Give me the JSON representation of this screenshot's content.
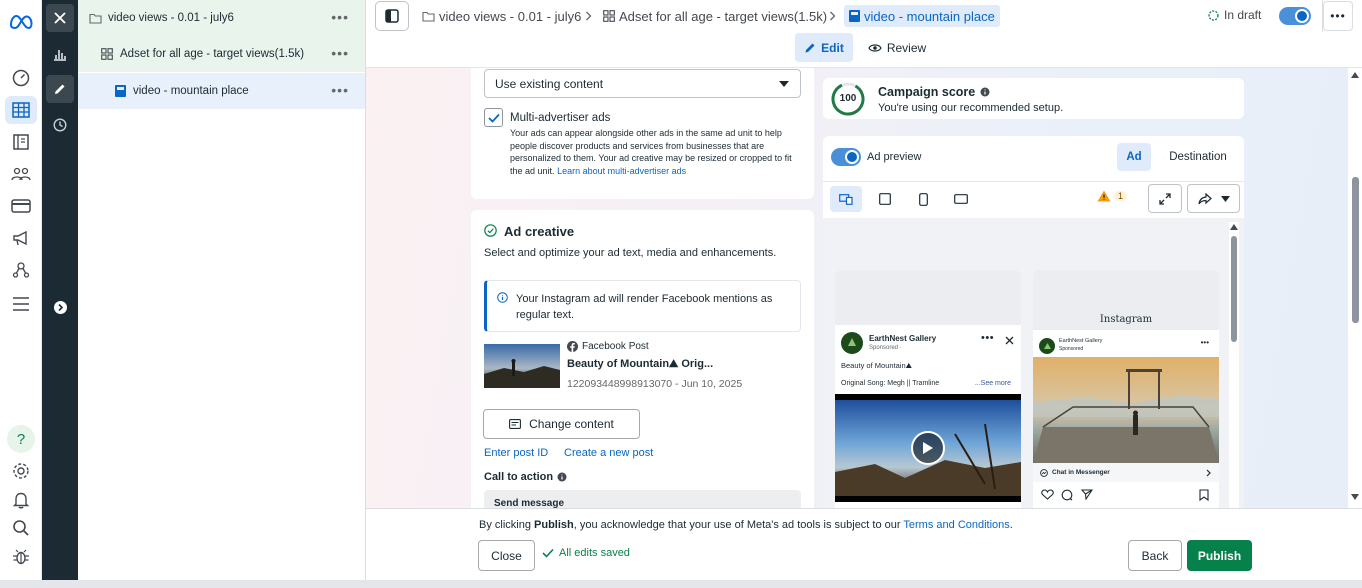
{
  "tree": {
    "items": [
      {
        "label": "video views - 0.01 - july6"
      },
      {
        "label": "Adset for all age - target views(1.5k)"
      },
      {
        "label": "video - mountain place"
      }
    ],
    "more": "•••"
  },
  "breadcrumb": {
    "campaign": "video views - 0.01 - july6",
    "adset": "Adset for all age - target views(1.5k)",
    "ad": "video - mountain place"
  },
  "status": {
    "label": "In draft"
  },
  "modes": {
    "edit": "Edit",
    "review": "Review"
  },
  "form": {
    "content_select": "Use existing content",
    "multi_adv": {
      "title": "Multi-advertiser ads",
      "desc": "Your ads can appear alongside other ads in the same ad unit to help people discover products and services from businesses that are personalized to them. Your ad creative may be resized or cropped to fit the ad unit.",
      "link": "Learn about multi-advertiser ads"
    },
    "creative": {
      "title": "Ad creative",
      "subtitle": "Select and optimize your ad text, media and enhancements.",
      "notice": "Your Instagram ad will render Facebook mentions as regular text.",
      "post_type": "Facebook Post",
      "post_title": "Beauty of Mountain⛰ Orig...",
      "post_meta": "122093448998913070 - Jun 10, 2025",
      "change_btn": "Change content",
      "enter_id": "Enter post ID",
      "create_new": "Create a new post",
      "cta_label": "Call to action",
      "cta_value": "Send message"
    }
  },
  "score": {
    "value": "100",
    "title": "Campaign score",
    "subtitle": "You're using our recommended setup."
  },
  "preview": {
    "toggle_label": "Ad preview",
    "tab_ad": "Ad",
    "tab_destination": "Destination",
    "warning_count": "1",
    "fb": {
      "page": "EarthNest Gallery",
      "sponsored": "Sponsored ·",
      "caption": "Beauty of Mountain⛰",
      "song": "Original Song: Megh || Tramline",
      "see_more": "...See more"
    },
    "ig": {
      "logo": "Instagram",
      "page": "EarthNest Gallery",
      "sponsored": "Sponsored",
      "cta": "Chat in Messenger"
    }
  },
  "footer": {
    "legal_prefix": "By clicking ",
    "legal_bold": "Publish",
    "legal_mid": ", you acknowledge that your use of Meta's ad tools is subject to our ",
    "legal_link": "Terms and Conditions",
    "legal_end": ".",
    "close": "Close",
    "saved": "All edits saved",
    "back": "Back",
    "publish": "Publish"
  },
  "colors": {
    "accent": "#0a66c2",
    "publish": "#07814c",
    "dark_rail": "#1c2b33",
    "selected_row": "#e7f0fb",
    "tree_bg_top": "#e7f5ec"
  }
}
